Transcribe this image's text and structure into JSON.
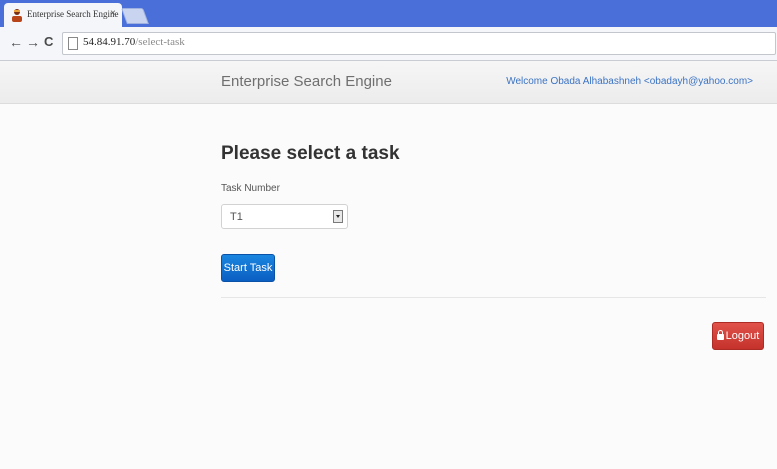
{
  "browser": {
    "tab": {
      "title": "Enterprise Search Engine",
      "close_glyph": "×",
      "favicon": "person-icon"
    },
    "nav": {
      "back_glyph": "←",
      "forward_glyph": "→",
      "reload_glyph": "C"
    },
    "address": {
      "host": "54.84.91.70",
      "path": "/select-task"
    },
    "colors": {
      "tabstrip": "#4a6fd8",
      "toolbar": "#f4f6f9"
    }
  },
  "navbar": {
    "brand": "Enterprise Search Engine",
    "welcome": "Welcome Obada Alhabashneh <obadayh@yahoo.com>"
  },
  "main": {
    "heading": "Please select a task",
    "field_label": "Task Number",
    "select_value": "T1",
    "start_button": "Start Task",
    "logout_button": "Logout"
  },
  "colors": {
    "primary": "#0b5fc2",
    "danger": "#c4322b",
    "link": "#3b73c4"
  }
}
